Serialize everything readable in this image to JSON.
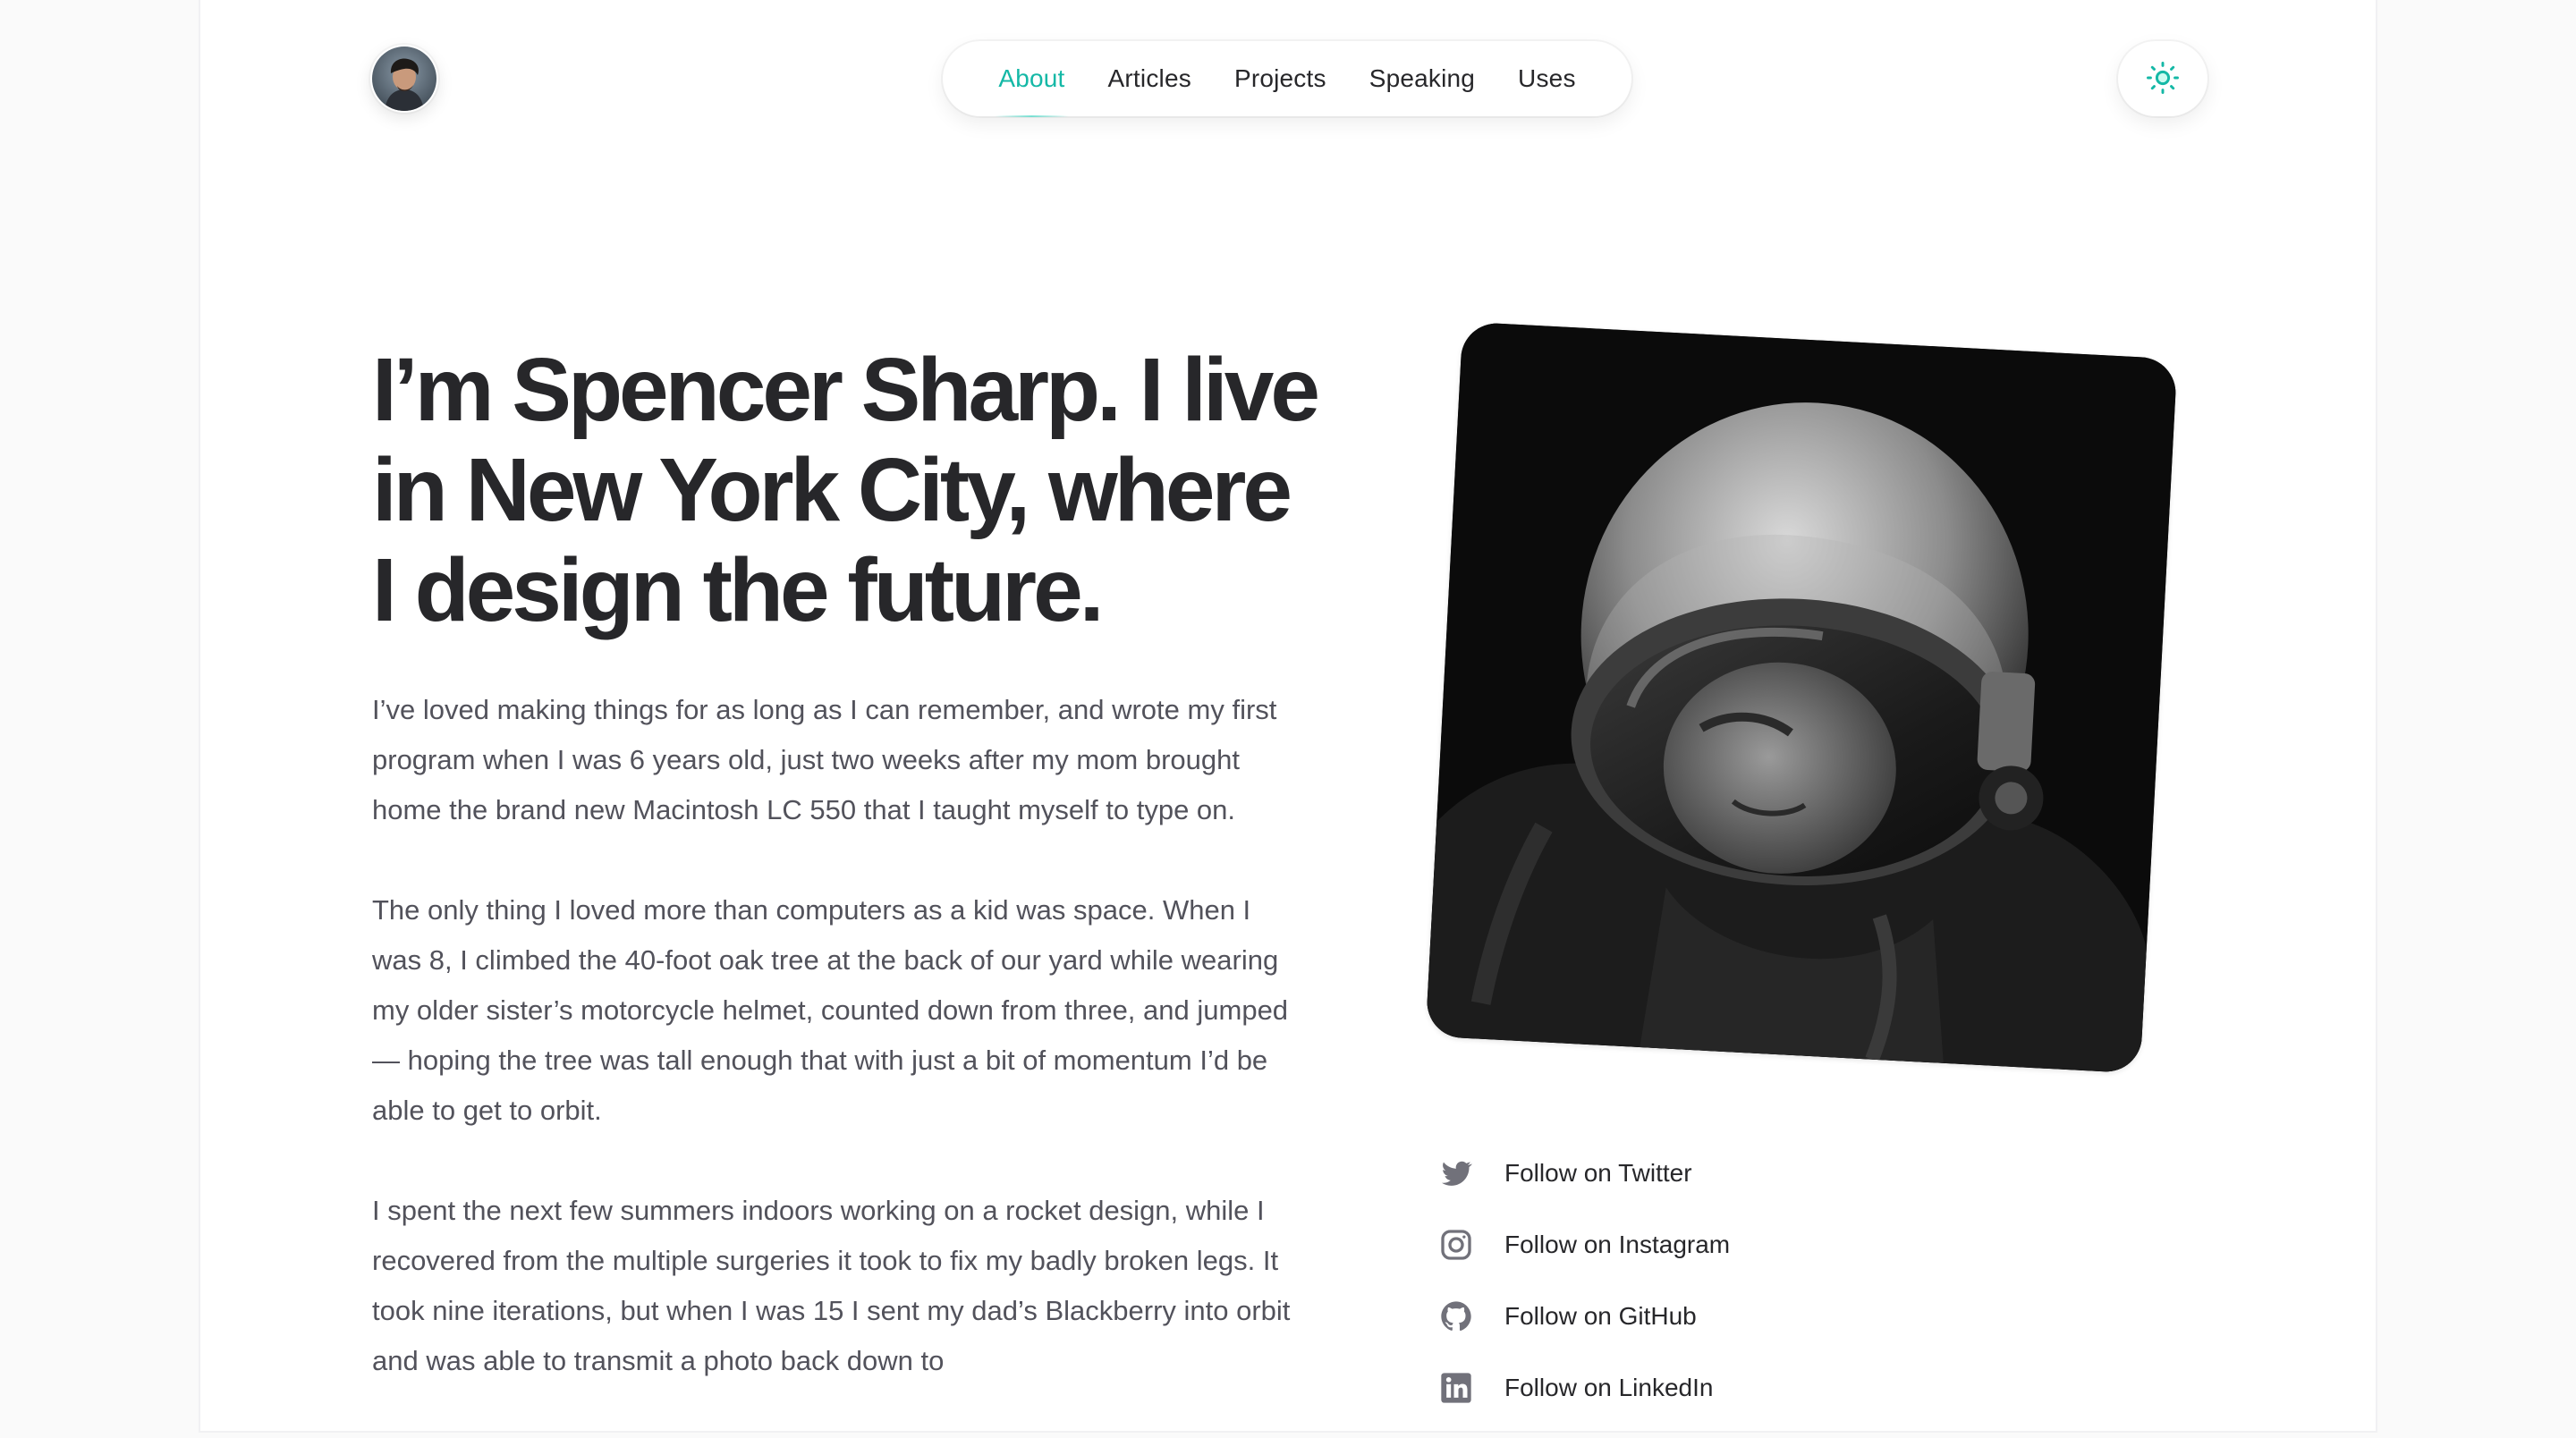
{
  "header": {
    "nav": [
      {
        "label": "About",
        "active": true
      },
      {
        "label": "Articles",
        "active": false
      },
      {
        "label": "Projects",
        "active": false
      },
      {
        "label": "Speaking",
        "active": false
      },
      {
        "label": "Uses",
        "active": false
      }
    ],
    "theme_toggle_icon": "sun-icon",
    "accent_color": "#14b8a6"
  },
  "hero": {
    "headline": "I’m Spencer Sharp. I live in New York City, where I design the future.",
    "paragraphs": [
      "I’ve loved making things for as long as I can remember, and wrote my first program when I was 6 years old, just two weeks after my mom brought home the brand new Macintosh LC 550 that I taught myself to type on.",
      "The only thing I loved more than computers as a kid was space. When I was 8, I climbed the 40-foot oak tree at the back of our yard while wearing my older sister’s motorcycle helmet, counted down from three, and jumped — hoping the tree was tall enough that with just a bit of momentum I’d be able to get to orbit.",
      "I spent the next few summers indoors working on a rocket design, while I recovered from the multiple surgeries it took to fix my badly broken legs. It took nine iterations, but when I was 15 I sent my dad’s Blackberry into orbit and was able to transmit a photo back down to"
    ]
  },
  "socials": [
    {
      "label": "Follow on Twitter",
      "icon": "twitter-icon"
    },
    {
      "label": "Follow on Instagram",
      "icon": "instagram-icon"
    },
    {
      "label": "Follow on GitHub",
      "icon": "github-icon"
    },
    {
      "label": "Follow on LinkedIn",
      "icon": "linkedin-icon"
    }
  ]
}
